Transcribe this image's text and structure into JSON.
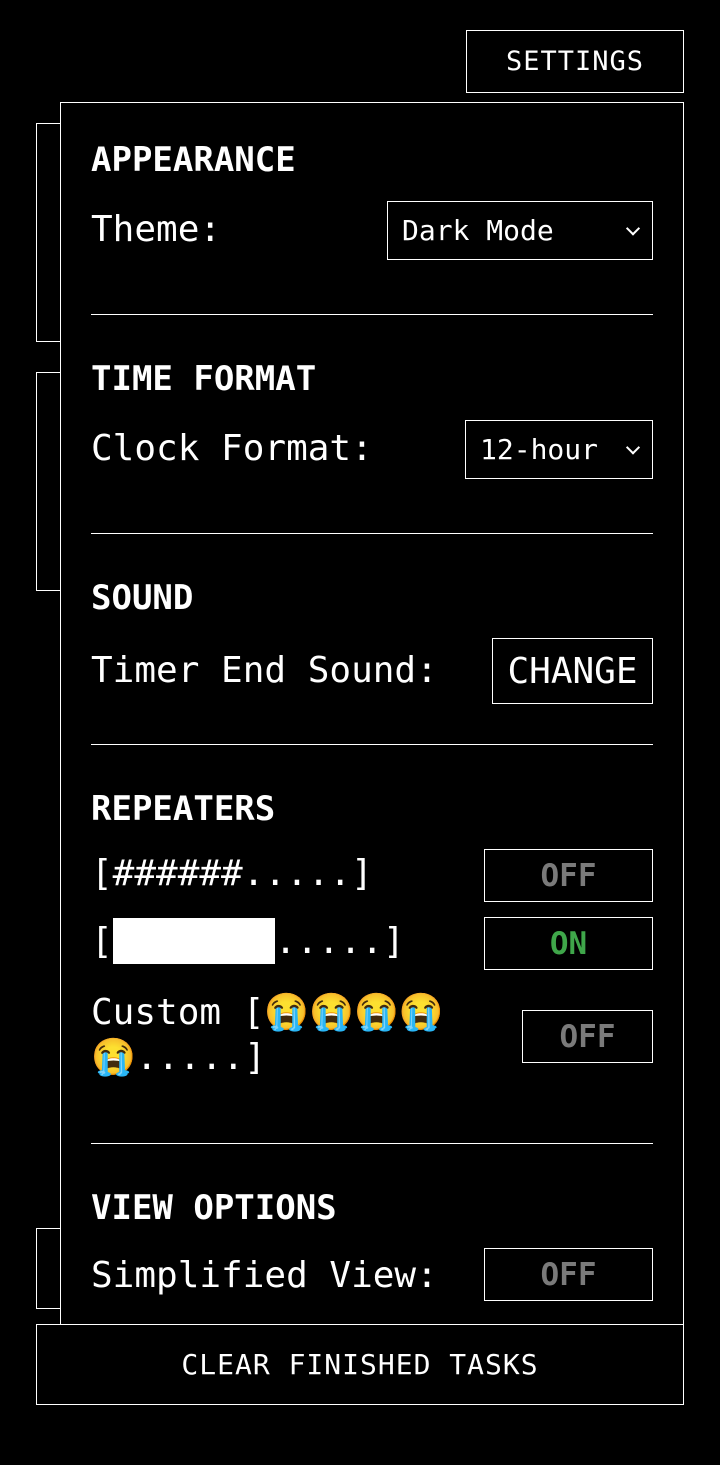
{
  "header": {
    "settings_label": "SETTINGS"
  },
  "appearance": {
    "heading": "APPEARANCE",
    "theme_label": "Theme:",
    "theme_value": "Dark Mode"
  },
  "time_format": {
    "heading": "TIME FORMAT",
    "clock_label": "Clock Format:",
    "clock_value": "12-hour"
  },
  "sound": {
    "heading": "SOUND",
    "timer_label": "Timer End Sound:",
    "change_label": "CHANGE"
  },
  "repeaters": {
    "heading": "REPEATERS",
    "items": [
      {
        "label": "[######.....]",
        "state": "OFF"
      },
      {
        "label_prefix": "[",
        "label_suffix": ".....]",
        "state": "ON"
      },
      {
        "label_line1": "Custom [😭😭😭😭",
        "label_line2": "😭.....]",
        "state": "OFF"
      }
    ]
  },
  "view_options": {
    "heading": "VIEW OPTIONS",
    "simplified_label": "Simplified View:",
    "simplified_state": "OFF"
  },
  "footer": {
    "clear_label": "CLEAR FINISHED TASKS"
  },
  "colors": {
    "background": "#000000",
    "foreground": "#ffffff",
    "toggle_on": "#3fa64a",
    "toggle_off": "#7a7a7a"
  },
  "icons": {
    "select_chevron": "chevron-down-icon"
  }
}
